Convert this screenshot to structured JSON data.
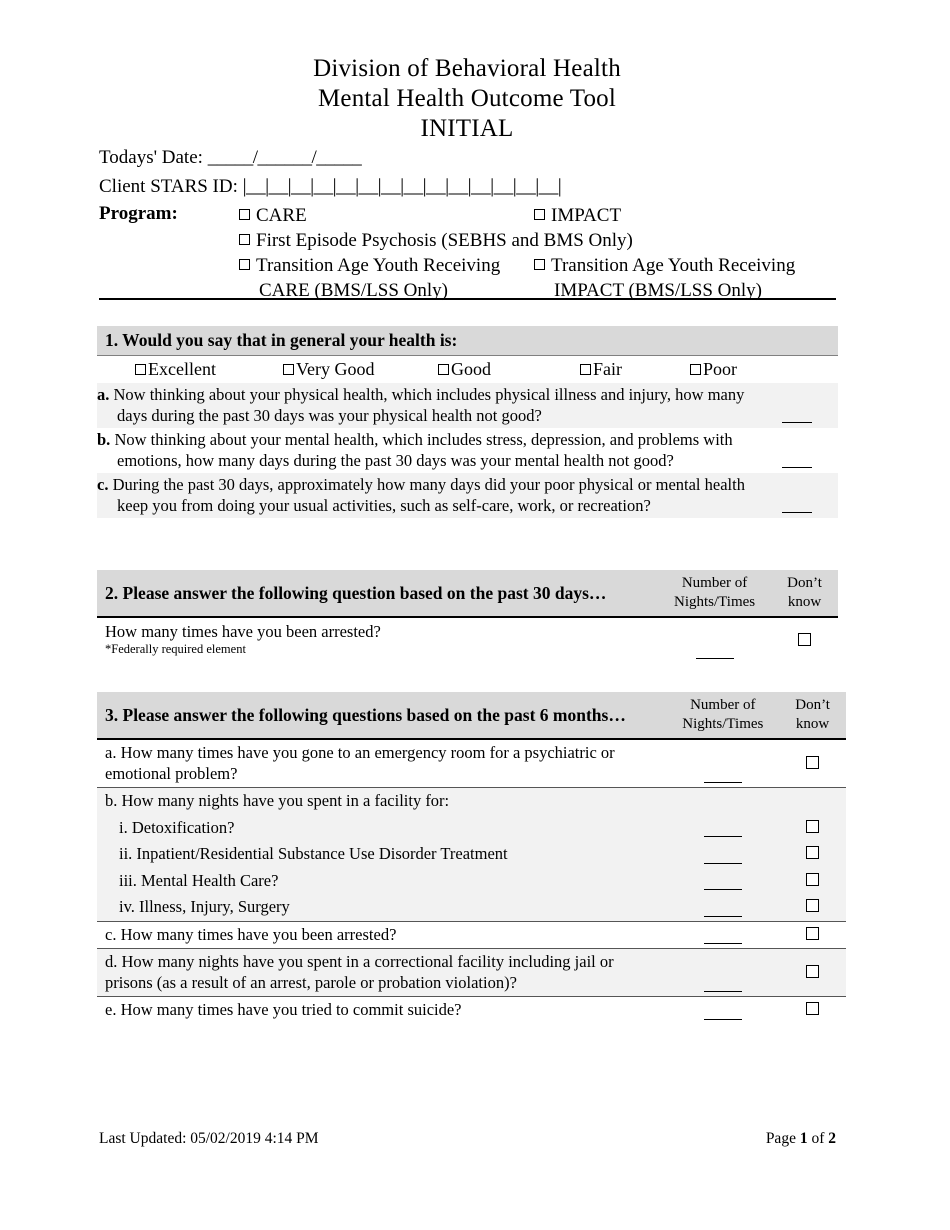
{
  "document": {
    "title_lines": [
      "Division of Behavioral Health",
      "Mental Health Outcome Tool",
      "INITIAL"
    ],
    "date_label": "Todays' Date:",
    "date_blank": "_____/______/_____",
    "stars_label": "Client STARS ID:",
    "stars_cells": 14
  },
  "program": {
    "label": "Program:",
    "options": [
      {
        "id": "care",
        "text": "CARE"
      },
      {
        "id": "impact",
        "text": "IMPACT"
      },
      {
        "id": "first-episode-psychosis",
        "text": "First Episode Psychosis (SEBHS and BMS Only)"
      },
      {
        "id": "tay-care",
        "text": "Transition Age Youth Receiving",
        "text2": "CARE (BMS/LSS Only)"
      },
      {
        "id": "tay-impact",
        "text": "Transition Age Youth Receiving",
        "text2": "IMPACT (BMS/LSS Only)"
      }
    ]
  },
  "q1": {
    "heading": "1. Would you say that in general your health is:",
    "options": [
      "Excellent",
      "Very Good",
      "Good",
      "Fair",
      "Poor"
    ],
    "items": [
      {
        "label": "a.",
        "text": "Now thinking about your physical health, which includes physical illness and injury, how many days during the past 30 days was your physical health not good?"
      },
      {
        "label": "b.",
        "text": "Now thinking about your mental health, which includes stress, depression, and problems with emotions, how many days during the past 30 days was your mental health not good?"
      },
      {
        "label": "c.",
        "text": "During the past 30 days, approximately how many days did your poor physical or mental health keep you from doing your usual activities, such as self-care, work, or recreation?"
      }
    ]
  },
  "q2": {
    "heading": "2. Please answer the following question based on the past 30 days…",
    "col_number": "Number of Nights/Times",
    "col_number_line1": "Number of",
    "col_number_line2": "Nights/Times",
    "col_dontknow_line1": "Don’t",
    "col_dontknow_line2": "know",
    "question": "How many times have you been arrested?",
    "note": "*Federally required element"
  },
  "q3": {
    "heading": "3.  Please answer the following questions based on the past 6 months…",
    "col_number_line1": "Number of",
    "col_number_line2": "Nights/Times",
    "col_dontknow_line1": "Don’t",
    "col_dontknow_line2": "know",
    "rows": [
      {
        "id": "a",
        "text": "a. How many times have you gone to an emergency room for a psychiatric or emotional problem?",
        "blank": true,
        "dontknow": true
      },
      {
        "id": "b",
        "text": "b. How many nights have you spent in a facility for:",
        "blank": false,
        "dontknow": false
      },
      {
        "id": "b-i",
        "text": "i. Detoxification?",
        "blank": true,
        "dontknow": true
      },
      {
        "id": "b-ii",
        "text": "ii. Inpatient/Residential Substance Use Disorder Treatment",
        "blank": true,
        "dontknow": true
      },
      {
        "id": "b-iii",
        "text": "iii. Mental Health Care?",
        "blank": true,
        "dontknow": true
      },
      {
        "id": "b-iv",
        "text": "iv. Illness, Injury, Surgery",
        "blank": true,
        "dontknow": true
      },
      {
        "id": "c",
        "text": "c. How many times have you been arrested?",
        "blank": true,
        "dontknow": true
      },
      {
        "id": "d",
        "text": "d. How many nights have you spent in a correctional facility including jail or prisons (as a result of an arrest, parole or probation violation)?",
        "blank": true,
        "dontknow": true
      },
      {
        "id": "e",
        "text": "e. How many times have you tried to commit suicide?",
        "blank": true,
        "dontknow": true
      }
    ]
  },
  "footer": {
    "last_updated": "Last Updated: 05/02/2019 4:14 PM",
    "page_prefix": "Page ",
    "page_current": "1",
    "page_middle": " of ",
    "page_total": "2"
  },
  "colors": {
    "heading_bg": "#d9d9d9",
    "shade_bg": "#f2f2f2",
    "rule": "#000000"
  }
}
